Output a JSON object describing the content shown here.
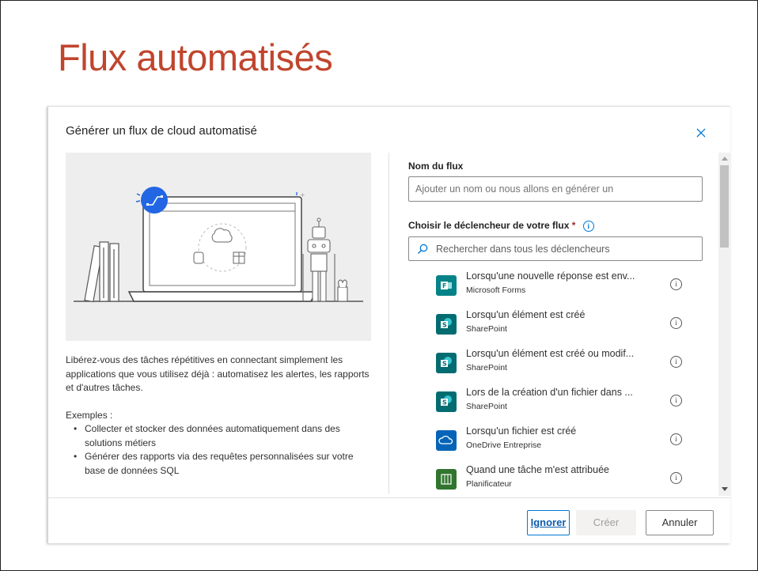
{
  "slide": {
    "title": "Flux automatisés"
  },
  "dialog": {
    "title": "Générer un flux de cloud automatisé",
    "close_icon": "close-icon",
    "description": "Libérez-vous des tâches répétitives en connectant simplement les applications que vous utilisez déjà : automatisez les alertes, les rapports et d'autres tâches.",
    "examples_heading": "Exemples :",
    "examples": [
      "Collecter et stocker des données automatiquement dans des solutions métiers",
      "Générer des rapports via des requêtes personnalisées sur votre base de données SQL"
    ],
    "flow_name": {
      "label": "Nom du flux",
      "placeholder": "Ajouter un nom ou nous allons en générer un",
      "value": ""
    },
    "trigger": {
      "label": "Choisir le déclencheur de votre flux",
      "required_mark": "*",
      "search_placeholder": "Rechercher dans tous les déclencheurs",
      "items": [
        {
          "title": "Lorsqu'une nouvelle réponse est env...",
          "source": "Microsoft Forms",
          "icon": "forms-icon",
          "color": "#038387"
        },
        {
          "title": "Lorsqu'un élément est créé",
          "source": "SharePoint",
          "icon": "sharepoint-icon",
          "color": "#036C70"
        },
        {
          "title": "Lorsqu'un élément est créé ou modif...",
          "source": "SharePoint",
          "icon": "sharepoint-icon",
          "color": "#036C70"
        },
        {
          "title": "Lors de la création d'un fichier dans ...",
          "source": "SharePoint",
          "icon": "sharepoint-icon",
          "color": "#036C70"
        },
        {
          "title": "Lorsqu'un fichier est créé",
          "source": "OneDrive Entreprise",
          "icon": "onedrive-icon",
          "color": "#0364B8"
        },
        {
          "title": "Quand une tâche m'est attribuée",
          "source": "Planificateur",
          "icon": "planner-icon",
          "color": "#31752F"
        }
      ]
    },
    "buttons": {
      "ignore": "Ignorer",
      "create": "Créer",
      "cancel": "Annuler"
    }
  },
  "colors": {
    "title": "#C0452D",
    "accent": "#0078D4"
  }
}
